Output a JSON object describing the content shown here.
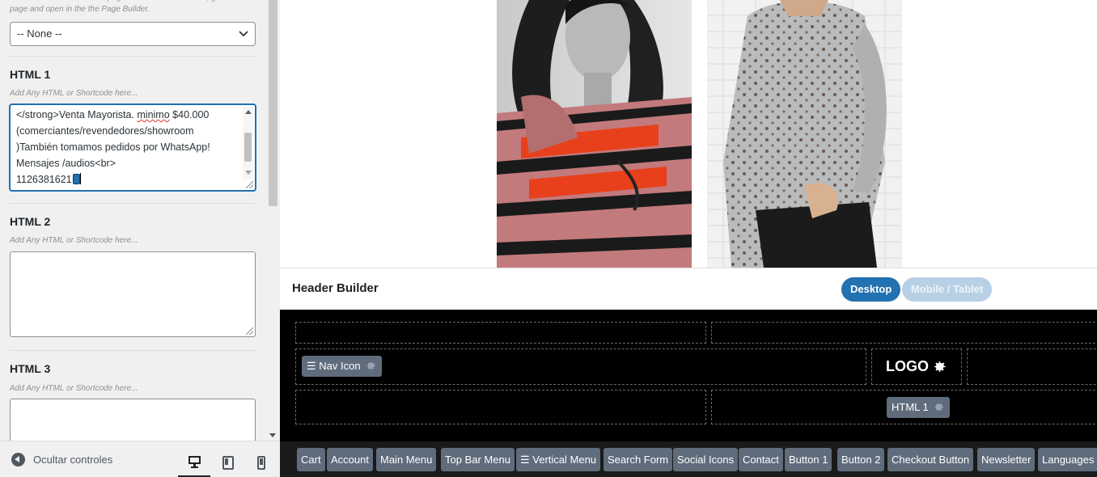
{
  "sidebar": {
    "top_note": "Blocks can be called in the page builder. Select a block, go to a page and open in the the Page Builder.",
    "block_select": {
      "value": "-- None --"
    },
    "sections": [
      {
        "title": "HTML 1",
        "hint": "Add Any HTML or Shortcode here...",
        "textarea_lines": [
          "</strong>Venta Mayorista. minimo $40.000",
          "(comerciantes/revendedores/showroom",
          ")También tomamos pedidos por WhatsApp!",
          "Mensajes /audios<br>",
          "1126381621"
        ]
      },
      {
        "title": "HTML 2",
        "hint": "Add Any HTML or Shortcode here...",
        "value": ""
      },
      {
        "title": "HTML 3",
        "hint": "Add Any HTML or Shortcode here...",
        "value": ""
      }
    ],
    "footer": {
      "hide_controls_label": "Ocultar controles",
      "devices": [
        "desktop-icon",
        "tablet-icon",
        "mobile-icon"
      ]
    }
  },
  "header_builder": {
    "title": "Header Builder",
    "tabs": {
      "desktop": "Desktop",
      "mobile": "Mobile / Tablet"
    },
    "active_tab": "desktop",
    "placed_items": {
      "nav_icon": "☰ Nav Icon",
      "logo": "LOGO",
      "html1": "HTML 1"
    },
    "available_items": [
      "Cart",
      "Account",
      "Main Menu",
      "Top Bar Menu",
      "☰ Vertical Menu",
      "Search Form",
      "Social Icons",
      "Contact",
      "Button 1",
      "Button 2",
      "Checkout Button",
      "Newsletter",
      "Languages"
    ]
  },
  "colors": {
    "accent": "#2271b1",
    "builder_bg": "#000000",
    "chip_bg": "#5f6c7c"
  }
}
